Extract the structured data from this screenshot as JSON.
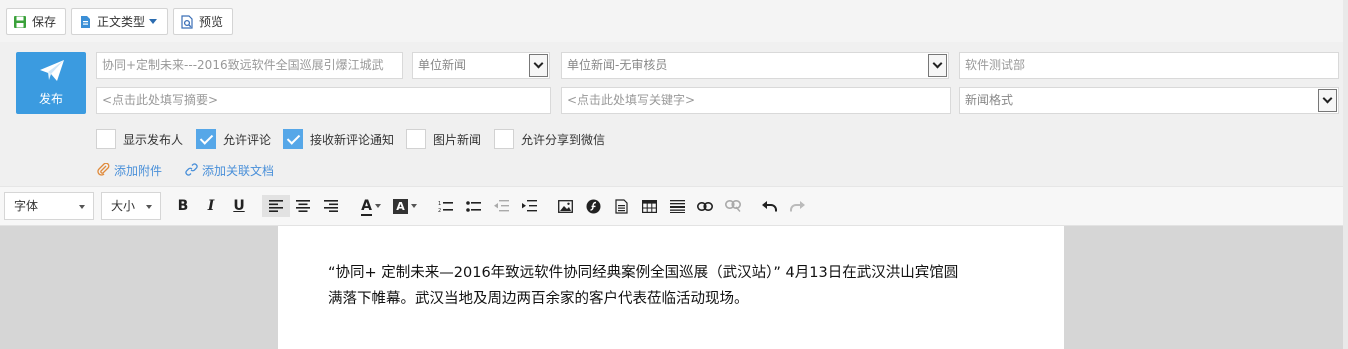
{
  "toolbar": {
    "save_label": "保存",
    "doc_type_label": "正文类型",
    "preview_label": "预览"
  },
  "form": {
    "publish_label": "发布",
    "title_value": "协同+定制未来---2016致远软件全国巡展引爆江城武",
    "unit_select_value": "单位新闻",
    "process_select_value": "单位新闻-无审核员",
    "department_value": "软件测试部",
    "summary_placeholder": "<点击此处填写摘要>",
    "keyword_placeholder": "<点击此处填写关键字>",
    "format_select_value": "新闻格式",
    "options": [
      {
        "label": "显示发布人",
        "checked": false
      },
      {
        "label": "允许评论",
        "checked": true
      },
      {
        "label": "接收新评论通知",
        "checked": true
      },
      {
        "label": "图片新闻",
        "checked": false
      },
      {
        "label": "允许分享到微信",
        "checked": false
      }
    ],
    "add_attachment_label": "添加附件",
    "add_related_doc_label": "添加关联文档"
  },
  "editor": {
    "font_label": "字体",
    "size_label": "大小",
    "bold": "B",
    "italic": "I",
    "underline": "U",
    "font_color": "A",
    "bg_color": "A",
    "content_line1": "“协同+ 定制未来—2016年致远软件协同经典案例全国巡展（武汉站）” 4月13日在武汉洪山宾馆圆",
    "content_line2": "满落下帷幕。武汉当地及周边两百余家的客户代表莅临活动现场。"
  },
  "colors": {
    "accent": "#3b9be0",
    "checkbox_on": "#56a7e8",
    "link": "#4a90d9",
    "save_icon": "#3aa13a"
  }
}
